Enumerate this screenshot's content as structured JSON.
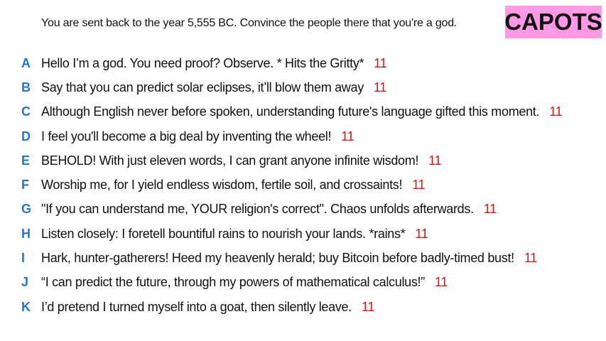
{
  "prompt": "You are sent back to the year 5,555 BC. Convince the people there that you're a god.",
  "badge": "CAPOTS",
  "colors": {
    "letter": "#1f77d4",
    "count": "#e01010",
    "badge_bg": "#ff99e6"
  },
  "answers": [
    {
      "letter": "A",
      "text": "Hello I’m a god. You need proof? Observe. * Hits the Gritty*",
      "count": "11"
    },
    {
      "letter": "B",
      "text": "Say that you can predict solar eclipses, it’ll blow them away",
      "count": "11"
    },
    {
      "letter": "C",
      "text": "Although English never before spoken, understanding future's language gifted this moment.",
      "count": "11"
    },
    {
      "letter": "D",
      "text": "I feel you'll become a big deal by inventing the wheel!",
      "count": "11"
    },
    {
      "letter": "E",
      "text": "BEHOLD! With just eleven words, I can grant anyone infinite wisdom!",
      "count": "11"
    },
    {
      "letter": "F",
      "text": "Worship me, for I yield endless wisdom, fertile soil, and crossaints!",
      "count": "11"
    },
    {
      "letter": "G",
      "text": "\"If you can understand me, YOUR religion's correct\". Chaos unfolds afterwards.",
      "count": "11"
    },
    {
      "letter": "H",
      "text": "Listen closely: I foretell bountiful rains to nourish your lands. *rains*",
      "count": "11"
    },
    {
      "letter": "I",
      "text": "Hark, hunter-gatherers! Heed my heavenly herald; buy Bitcoin before badly-timed bust!",
      "count": "11"
    },
    {
      "letter": "J",
      "text": "“I can predict the future, through my powers of mathematical calculus!”",
      "count": "11"
    },
    {
      "letter": "K",
      "text": "I’d pretend I turned myself into a goat, then silently leave.",
      "count": "11"
    }
  ]
}
